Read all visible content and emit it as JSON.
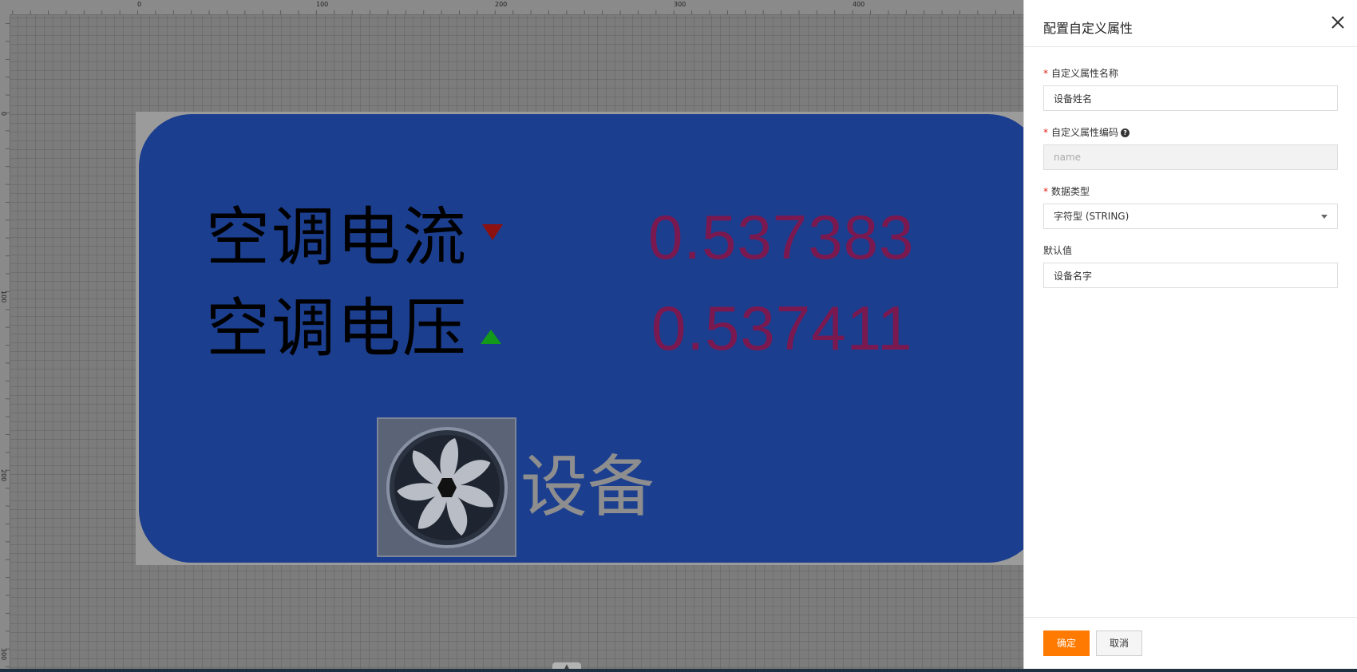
{
  "editor": {
    "ruler_top_labels": [
      "0",
      "100",
      "200",
      "300",
      "400"
    ],
    "ruler_left_labels": [
      "0",
      "100",
      "200",
      "300"
    ],
    "card": {
      "rows": [
        {
          "label": "空调电流",
          "trend": "down",
          "trend_color": "#8c1111",
          "value": "0.537383"
        },
        {
          "label": "空调电压",
          "trend": "up",
          "trend_color": "#139a1a",
          "value": "0.537411"
        }
      ],
      "device_label": "设备",
      "card_color": "#1b3e8f",
      "value_color": "#7a1850",
      "fan_icon": "fan-icon"
    },
    "scroll_handle_glyph": "▲"
  },
  "drawer": {
    "title": "配置自定义属性",
    "close_icon": "close-icon",
    "fields": {
      "name": {
        "label": "自定义属性名称",
        "required": "*",
        "value": "设备姓名"
      },
      "code": {
        "label": "自定义属性编码",
        "required": "*",
        "placeholder": "name",
        "help_icon": "?"
      },
      "datatype": {
        "label": "数据类型",
        "required": "*",
        "value": "字符型 (STRING)"
      },
      "default": {
        "label": "默认值",
        "value": "设备名字"
      }
    },
    "footer": {
      "confirm_label": "确定",
      "cancel_label": "取消"
    },
    "accent_color": "#ff7a00"
  }
}
